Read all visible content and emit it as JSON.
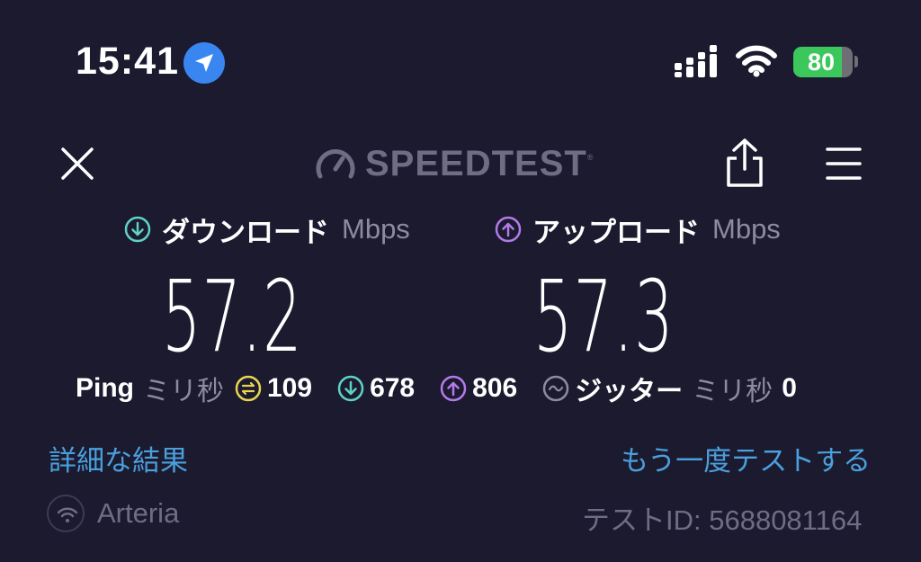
{
  "status_bar": {
    "time": "15:41",
    "battery_level": "80",
    "location_active": true
  },
  "nav": {
    "brand": "SPEEDTEST",
    "brand_tm": "®"
  },
  "download": {
    "label": "ダウンロード",
    "unit": "Mbps",
    "value": "57.2",
    "icon": "arrow-down-circle-icon",
    "color": "#5fd1c6"
  },
  "upload": {
    "label": "アップロード",
    "unit": "Mbps",
    "value": "57.3",
    "icon": "arrow-up-circle-icon",
    "color": "#b47ae8"
  },
  "ping": {
    "label": "Ping",
    "unit": "ミリ秒",
    "idle": "109",
    "idle_color": "#e9d44f",
    "download": "678",
    "upload": "806"
  },
  "jitter": {
    "label": "ジッター",
    "unit": "ミリ秒",
    "value": "0"
  },
  "links": {
    "details": "詳細な結果",
    "retest": "もう一度テストする"
  },
  "footer": {
    "isp": "Arteria",
    "test_id": "テストID: 5688081164"
  },
  "colors": {
    "background": "#1b1a2f",
    "accent_link": "#4a9fdc",
    "muted": "#8d8c9e"
  }
}
